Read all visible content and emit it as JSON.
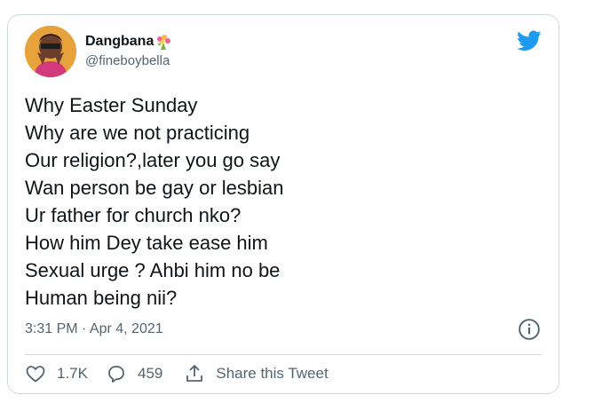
{
  "author": {
    "display_name": "Dangbana",
    "handle": "@fineboybella",
    "avatar_icon": "user-avatar-photo",
    "name_emoji": "bouquet-icon"
  },
  "tweet": {
    "lines": [
      "Why Easter Sunday",
      "Why are we not practicing",
      "Our religion?,later you go say",
      "Wan person be gay or lesbian",
      "Ur father for church nko?",
      "How him Dey take ease him",
      "Sexual urge ? Ahbi him no be",
      "Human being nii?"
    ],
    "timestamp": "3:31 PM · Apr 4, 2021"
  },
  "actions": {
    "likes": "1.7K",
    "replies": "459",
    "share_label": "Share this Tweet"
  },
  "colors": {
    "twitter_blue": "#1d9bf0",
    "text": "#0f1419",
    "muted": "#536471",
    "border": "#cfd9de"
  }
}
